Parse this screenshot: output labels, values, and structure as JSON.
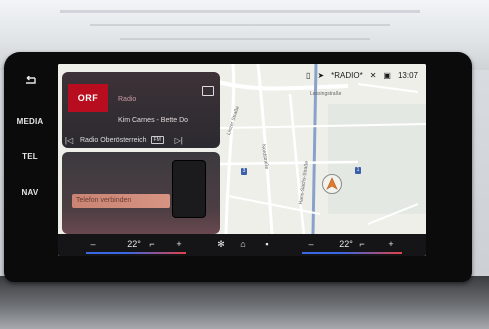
{
  "left_rail": {
    "back_icon": "back-arrow-icon",
    "items": [
      {
        "label": "MEDIA"
      },
      {
        "label": "TEL"
      },
      {
        "label": "NAV"
      }
    ]
  },
  "status_bar": {
    "radio_label": "*RADIO*",
    "time": "13:07"
  },
  "media_card": {
    "source_label": "Radio",
    "artist_title": "Kim Carnes - Bette Do",
    "station": "Radio Oberösterreich",
    "band": "FM",
    "logo_text": "ORF"
  },
  "phone_card": {
    "connect_label": "Telefon verbinden"
  },
  "map": {
    "streets": [
      {
        "label": "Lessingstraße"
      },
      {
        "label": "Linzer Straße"
      },
      {
        "label": "Nordstraße"
      },
      {
        "label": "Hans-Sachs-Straße"
      }
    ],
    "road_badges": [
      "3",
      "1"
    ]
  },
  "bottom_bar": {
    "left_minus": "–",
    "left_temp": "22°",
    "left_plus": "+",
    "right_minus": "–",
    "right_temp": "22°",
    "right_plus": "+"
  },
  "colors": {
    "orf_red": "#b80d1e",
    "temp_blue": "#3b68e0",
    "temp_red": "#e0424a"
  }
}
